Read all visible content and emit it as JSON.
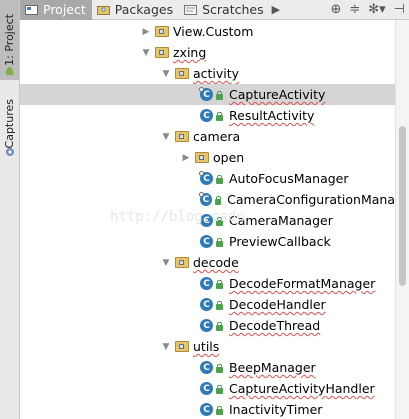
{
  "toolwindow_strip": {
    "project_tab": "1: Project",
    "captures_tab": "Captures"
  },
  "toolbar": {
    "tabs": [
      {
        "label": "Project",
        "active": true
      },
      {
        "label": "Packages",
        "active": false
      },
      {
        "label": "Scratches",
        "active": false
      }
    ],
    "more_tabs_icon": "chevron-right-icon",
    "actions": [
      "crosshair-icon",
      "collapse-icon",
      "gear-icon",
      "hide-panel-icon"
    ]
  },
  "tree": {
    "rows": [
      {
        "label": "View.Custom",
        "kind": "package",
        "expanded": false,
        "depth": 0
      },
      {
        "label": "zxing",
        "kind": "package",
        "expanded": true,
        "depth": 0
      },
      {
        "label": "activity",
        "kind": "package",
        "expanded": true,
        "depth": 1
      },
      {
        "label": "CaptureActivity",
        "kind": "class",
        "depth": 2,
        "selected": true
      },
      {
        "label": "ResultActivity",
        "kind": "class",
        "depth": 2
      },
      {
        "label": "camera",
        "kind": "package",
        "expanded": true,
        "depth": 1
      },
      {
        "label": "open",
        "kind": "package",
        "expanded": false,
        "depth": 2
      },
      {
        "label": "AutoFocusManager",
        "kind": "class",
        "depth": 2
      },
      {
        "label": "CameraConfigurationMana",
        "kind": "class",
        "depth": 2
      },
      {
        "label": "CameraManager",
        "kind": "class",
        "depth": 2
      },
      {
        "label": "PreviewCallback",
        "kind": "class",
        "depth": 2
      },
      {
        "label": "decode",
        "kind": "package",
        "expanded": true,
        "depth": 1
      },
      {
        "label": "DecodeFormatManager",
        "kind": "class",
        "depth": 2
      },
      {
        "label": "DecodeHandler",
        "kind": "class",
        "depth": 2
      },
      {
        "label": "DecodeThread",
        "kind": "class",
        "depth": 2
      },
      {
        "label": "utils",
        "kind": "package",
        "expanded": true,
        "depth": 1
      },
      {
        "label": "BeepManager",
        "kind": "class",
        "depth": 2
      },
      {
        "label": "CaptureActivityHandler",
        "kind": "class",
        "depth": 2
      },
      {
        "label": "InactivityTimer",
        "kind": "class",
        "depth": 2
      }
    ]
  },
  "watermark": "http://blog.csdn.",
  "colors": {
    "class_icon": "#2f7ab8",
    "folder": "#e6c56b",
    "selection": "#d5d5d5",
    "active_tab": "#a8a8a8",
    "error_underline": "#e05050"
  }
}
